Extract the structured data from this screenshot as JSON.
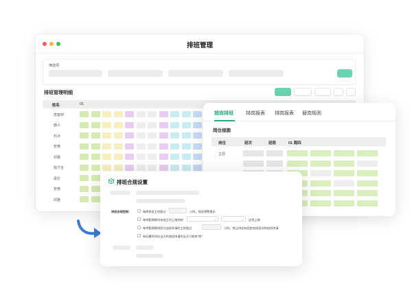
{
  "main_window": {
    "title": "排班管理",
    "filter_label": "筛选项",
    "table_title": "排班管理明细",
    "header": {
      "name": "姓名",
      "first_day": "01"
    },
    "rows": [
      "唐客婷",
      "鹿义",
      "石冰",
      "管艳",
      "邓雅",
      "衡才言",
      "梁乐",
      "管艳",
      "邓雅"
    ]
  },
  "right_window": {
    "tabs": [
      "按岗排班",
      "排岗报表",
      "排岗报表",
      "替岗规则"
    ],
    "active_tab": 0,
    "subtitle": "岗位视图",
    "header": {
      "position": "岗位",
      "shift": "班次",
      "group": "班段",
      "day": "01 周四"
    },
    "first_row_label": "主厨"
  },
  "dialog": {
    "title": "排班合规设置",
    "section_label": "排班合规控制：",
    "rules": [
      {
        "text_before": "每周排班工时超过",
        "text_after": "小时，排班预警提示"
      },
      {
        "text_before": "每考勤周期内排班工时上限控制",
        "text_after": "达到上限"
      },
      {
        "text_before": "每考勤周期排班与加班申请的工时超过",
        "text_after": "小时，禁止排含有固定加班班次和加班申请"
      },
      {
        "text_before": "有旧属时间在当天的加班申请的当天只能排\"休\"",
        "text_after": ""
      }
    ]
  },
  "colors": {
    "accent": "#2aa77e",
    "green_btn": "#6cd3b2",
    "arrow": "#3a7bd5"
  }
}
